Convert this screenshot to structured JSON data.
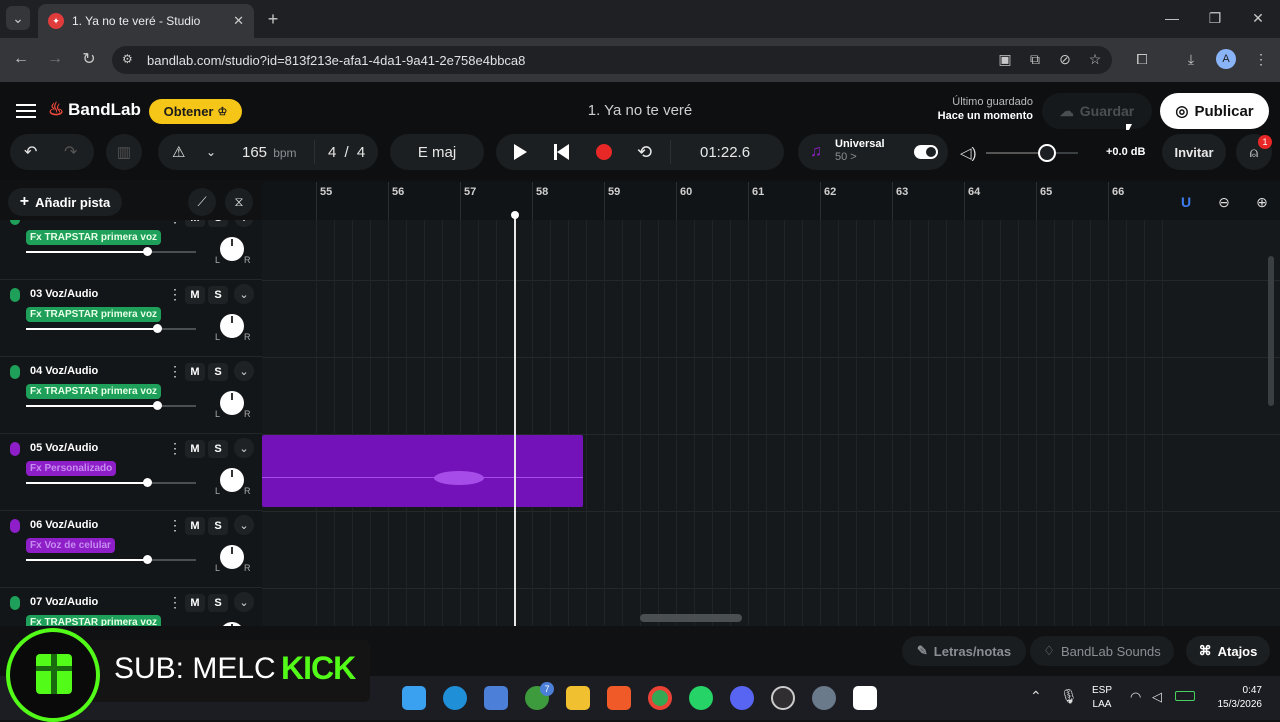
{
  "browser": {
    "tab_title": "1. Ya no te veré - Studio",
    "url": "bandlab.com/studio?id=813f213e-afa1-4da1-9a41-2e758e4bbca8"
  },
  "header": {
    "brand": "BandLab",
    "obtener": "Obtener",
    "project_title": "1. Ya no te veré",
    "last_saved_label": "Último guardado",
    "last_saved_value": "Hace un momento",
    "save": "Guardar",
    "publish": "Publicar"
  },
  "toolbar": {
    "bpm_value": "165",
    "bpm_unit": "bpm",
    "time_sig_num": "4",
    "time_sig_sep": "/",
    "time_sig_den": "4",
    "key": "E maj",
    "time": "01:22.6",
    "tuner_title": "Universal",
    "tuner_value": "50 >",
    "volume_db": "+0.0 dB",
    "invite": "Invitar",
    "notif_count": "1"
  },
  "track_controls": {
    "add_track": "Añadir pista"
  },
  "ruler": {
    "bars": [
      "55",
      "56",
      "57",
      "58",
      "59",
      "60",
      "61",
      "62",
      "63",
      "64",
      "65",
      "66"
    ]
  },
  "tracks": [
    {
      "name": "",
      "fx": "Fx TRAPSTAR primera voz",
      "fx_color": "green",
      "mic_color": "#1fa05a",
      "volume": 0.71
    },
    {
      "name": "03 Voz/Audio",
      "fx": "Fx TRAPSTAR primera voz",
      "fx_color": "green",
      "mic_color": "#1fa05a",
      "volume": 0.77
    },
    {
      "name": "04 Voz/Audio",
      "fx": "Fx TRAPSTAR primera voz",
      "fx_color": "green",
      "mic_color": "#1fa05a",
      "volume": 0.77
    },
    {
      "name": "05 Voz/Audio",
      "fx": "Fx Personalizado",
      "fx_color": "purple",
      "mic_color": "#8d1ec8",
      "volume": 0.71
    },
    {
      "name": "06 Voz/Audio",
      "fx": "Fx Voz de celular",
      "fx_color": "purple",
      "mic_color": "#8d1ec8",
      "volume": 0.71
    },
    {
      "name": "07 Voz/Audio",
      "fx": "Fx TRAPSTAR primera voz",
      "fx_color": "green",
      "mic_color": "#1fa05a",
      "volume": 0.77
    }
  ],
  "mute_label": "M",
  "solo_label": "S",
  "pan_left": "L",
  "pan_right": "R",
  "bottom": {
    "lyrics": "Letras/notas",
    "sounds": "BandLab Sounds",
    "shortcuts": "Atajos"
  },
  "overlay": {
    "sub_text": "SUB: MELC",
    "kick_text": "KICK"
  },
  "taskbar": {
    "lang1": "ESP",
    "lang2": "LAA",
    "clock_time": "0:47",
    "clock_date": "15/3/2026",
    "xbox_badge": "7"
  },
  "colors": {
    "accent_yellow": "#f5c518",
    "region_purple": "#7312b8",
    "fx_green": "#1fa05a",
    "record_red": "#e82727"
  }
}
